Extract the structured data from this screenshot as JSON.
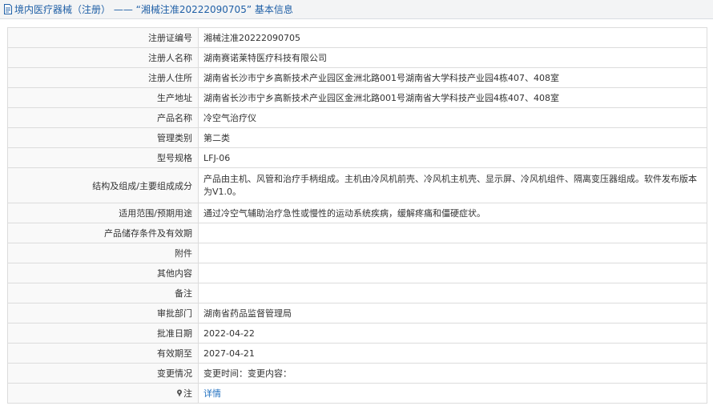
{
  "header": {
    "title": "境内医疗器械（注册） —— “湘械注准20222090705” 基本信息",
    "icon": "document-icon"
  },
  "rows": [
    {
      "label": "注册证编号",
      "value": "湘械注准20222090705"
    },
    {
      "label": "注册人名称",
      "value": "湖南赛诺莱特医疗科技有限公司"
    },
    {
      "label": "注册人住所",
      "value": "湖南省长沙市宁乡高新技术产业园区金洲北路001号湖南省大学科技产业园4栋407、408室"
    },
    {
      "label": "生产地址",
      "value": "湖南省长沙市宁乡高新技术产业园区金洲北路001号湖南省大学科技产业园4栋407、408室"
    },
    {
      "label": "产品名称",
      "value": "冷空气治疗仪"
    },
    {
      "label": "管理类别",
      "value": "第二类"
    },
    {
      "label": "型号规格",
      "value": "LFJ-06"
    },
    {
      "label": "结构及组成/主要组成成分",
      "value": "产品由主机、风管和治疗手柄组成。主机由冷风机前壳、冷风机主机壳、显示屏、冷风机组件、隔离变压器组成。软件发布版本为V1.0。"
    },
    {
      "label": "适用范围/预期用途",
      "value": "通过冷空气辅助治疗急性或慢性的运动系统疾病，缓解疼痛和僵硬症状。"
    },
    {
      "label": "产品储存条件及有效期",
      "value": ""
    },
    {
      "label": "附件",
      "value": ""
    },
    {
      "label": "其他内容",
      "value": ""
    },
    {
      "label": "备注",
      "value": ""
    },
    {
      "label": "审批部门",
      "value": "湖南省药品监督管理局"
    },
    {
      "label": "批准日期",
      "value": "2022-04-22"
    },
    {
      "label": "有效期至",
      "value": "2027-04-21"
    },
    {
      "label": "变更情况",
      "value": "变更时间：变更内容："
    }
  ],
  "note_row": {
    "label": "注",
    "icon": "pin-icon",
    "link_text": "详情"
  }
}
